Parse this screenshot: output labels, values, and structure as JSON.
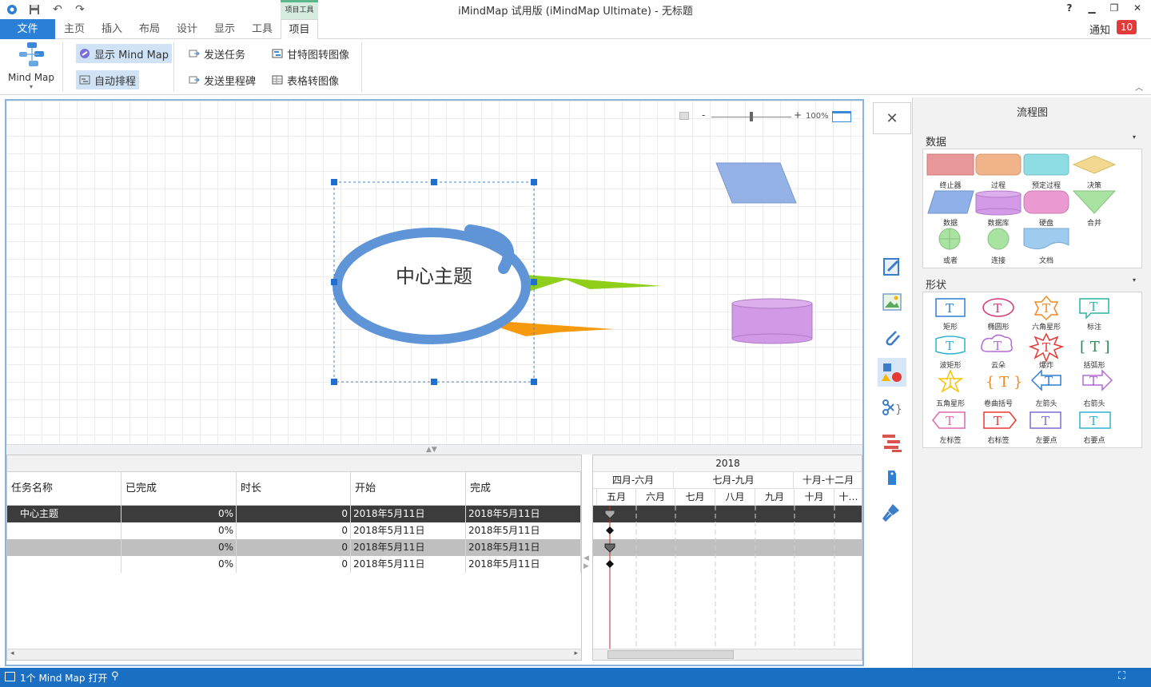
{
  "window": {
    "title": "iMindMap 试用版 (iMindMap Ultimate) - 无标题",
    "context_group": "项目工具"
  },
  "tabs": [
    "文件",
    "主页",
    "插入",
    "布局",
    "设计",
    "显示",
    "工具",
    "项目"
  ],
  "notify": {
    "label": "通知",
    "count": "10"
  },
  "ribbon": {
    "mindmap_label": "Mind Map",
    "show_mindmap": "显示 Mind Map",
    "auto_schedule": "自动排程",
    "send_task": "发送任务",
    "send_milestone": "发送里程碑",
    "gantt_to_image": "甘特图转图像",
    "table_to_image": "表格转图像"
  },
  "canvas": {
    "central_topic": "中心主题",
    "zoom": "100%"
  },
  "task_table": {
    "headers": [
      "任务名称",
      "已完成",
      "时长",
      "开始",
      "完成"
    ],
    "rows": [
      {
        "name": "中心主题",
        "done": "0%",
        "dur": "0",
        "start": "2018年5月11日",
        "end": "2018年5月11日"
      },
      {
        "name": "",
        "done": "0%",
        "dur": "0",
        "start": "2018年5月11日",
        "end": "2018年5月11日"
      },
      {
        "name": "",
        "done": "0%",
        "dur": "0",
        "start": "2018年5月11日",
        "end": "2018年5月11日"
      },
      {
        "name": "",
        "done": "0%",
        "dur": "0",
        "start": "2018年5月11日",
        "end": "2018年5月11日"
      }
    ]
  },
  "gantt": {
    "year": "2018",
    "quarters": [
      "四月-六月",
      "七月-九月",
      "十月-十二月"
    ],
    "months": [
      "五月",
      "六月",
      "七月",
      "八月",
      "九月",
      "十月",
      "十…"
    ]
  },
  "panel": {
    "title": "流程图",
    "data_section": "数据",
    "data_shapes": [
      "终止器",
      "过程",
      "预定过程",
      "决策",
      "数据",
      "数据库",
      "硬盘",
      "合并",
      "或者",
      "连接",
      "文档"
    ],
    "shape_section": "形状",
    "shapes": [
      "矩形",
      "椭圆形",
      "六角星形",
      "标注",
      "波矩形",
      "云朵",
      "爆炸",
      "括弧形",
      "五角星形",
      "卷曲括号",
      "左箭头",
      "右箭头",
      "左标签",
      "右标签",
      "左要点",
      "右要点"
    ]
  },
  "status": {
    "text": "1个 Mind Map 打开"
  },
  "colors": {
    "accent": "#2a7fd6",
    "status": "#1b6fc2",
    "badge": "#e23b3b"
  }
}
